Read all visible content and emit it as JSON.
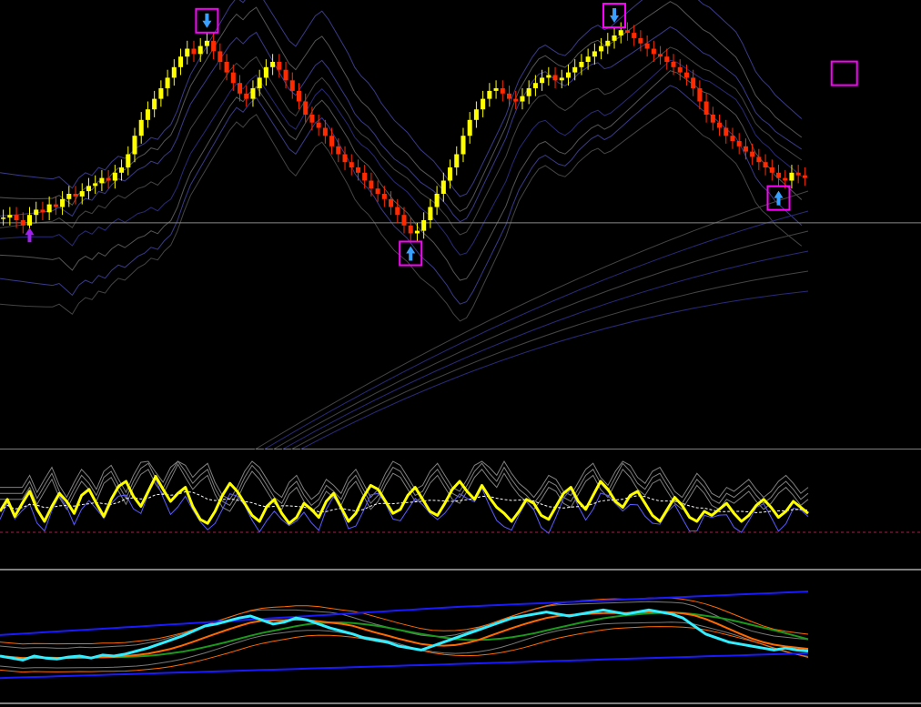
{
  "chart_data": [
    {
      "type": "candlestick",
      "panel": "price",
      "title": "",
      "xlabel": "",
      "ylabel": "",
      "colors": {
        "up": "#ffff00",
        "down": "#ff2a00",
        "signal_box": "#ff00ff",
        "arrow_up": "#3aa0ff",
        "arrow_down": "#3aa0ff",
        "zigzag": "#8a2be2"
      },
      "close": [
        21,
        22,
        20,
        18,
        22,
        24,
        23,
        26,
        25,
        28,
        30,
        29,
        31,
        33,
        34,
        36,
        35,
        38,
        40,
        45,
        52,
        58,
        62,
        66,
        70,
        74,
        78,
        82,
        85,
        83,
        86,
        88,
        84,
        80,
        76,
        72,
        68,
        66,
        70,
        74,
        78,
        80,
        77,
        73,
        69,
        65,
        60,
        57,
        55,
        52,
        48,
        45,
        42,
        40,
        38,
        35,
        32,
        30,
        28,
        25,
        22,
        18,
        15,
        16,
        20,
        25,
        30,
        35,
        40,
        45,
        52,
        58,
        62,
        66,
        69,
        70,
        68,
        66,
        65,
        67,
        70,
        72,
        74,
        75,
        73,
        74,
        76,
        78,
        80,
        82,
        84,
        86,
        88,
        90,
        92,
        91,
        89,
        87,
        85,
        83,
        82,
        80,
        78,
        76,
        74,
        70,
        65,
        60,
        57,
        55,
        52,
        50,
        48,
        46,
        44,
        42,
        40,
        38,
        36,
        35,
        38,
        37,
        36
      ],
      "signals": [
        {
          "type": "up",
          "index": 4,
          "boxed": false
        },
        {
          "type": "down",
          "index": 31,
          "boxed": true
        },
        {
          "type": "up",
          "index": 62,
          "boxed": true
        },
        {
          "type": "down",
          "index": 93,
          "boxed": true
        },
        {
          "type": "up",
          "index": 118,
          "boxed": true
        },
        {
          "type": "box",
          "index": 128,
          "boxed": true
        }
      ],
      "horizontal_line": {
        "value": 19
      }
    },
    {
      "type": "line",
      "panel": "oscillator",
      "colors": {
        "main": "#ffff00",
        "signal": "#ffffff",
        "bands": "#808080",
        "zero_line": "#a0204a"
      },
      "series": [
        {
          "values": [
            50,
            62,
            45,
            58,
            70,
            52,
            40,
            55,
            68,
            60,
            48,
            66,
            72,
            58,
            45,
            62,
            75,
            80,
            65,
            55,
            70,
            85,
            72,
            60,
            68,
            74,
            55,
            42,
            38,
            50,
            66,
            78,
            70,
            58,
            46,
            40,
            55,
            62,
            48,
            38,
            44,
            58,
            52,
            44,
            60,
            68,
            54,
            40,
            48,
            64,
            76,
            72,
            60,
            48,
            52,
            66,
            74,
            62,
            50,
            46,
            58,
            72,
            80,
            70,
            62,
            76,
            64,
            54,
            48,
            40,
            50,
            62,
            58,
            46,
            42,
            55,
            68,
            74,
            60,
            52,
            66,
            80,
            72,
            60,
            54,
            66,
            70,
            58,
            46,
            40,
            52,
            64,
            56,
            44,
            40,
            50,
            46,
            52,
            58,
            48,
            40,
            46,
            56,
            62,
            54,
            44,
            50,
            60,
            54,
            48
          ]
        },
        {
          "values": []
        }
      ],
      "ylim": [
        0,
        100
      ]
    },
    {
      "type": "line",
      "panel": "bands",
      "colors": {
        "main": "#33eeff",
        "ma_fast": "#ff6a00",
        "ma_slow": "#1a9a1a",
        "upper": "#1a1aff",
        "lower": "#1a1aff",
        "envelope": "#7a7a7a"
      },
      "series": [
        {
          "values": [
            30,
            28,
            26,
            30,
            28,
            27,
            29,
            30,
            28,
            31,
            30,
            32,
            35,
            38,
            42,
            46,
            50,
            55,
            60,
            62,
            65,
            68,
            70,
            66,
            62,
            64,
            68,
            66,
            62,
            58,
            55,
            52,
            48,
            46,
            44,
            40,
            38,
            36,
            40,
            44,
            48,
            52,
            56,
            60,
            64,
            68,
            70,
            72,
            74,
            72,
            70,
            72,
            74,
            76,
            74,
            72,
            74,
            76,
            74,
            72,
            68,
            60,
            52,
            48,
            44,
            42,
            40,
            38,
            36,
            38,
            36,
            35
          ]
        }
      ],
      "ylim": [
        0,
        100
      ]
    }
  ]
}
